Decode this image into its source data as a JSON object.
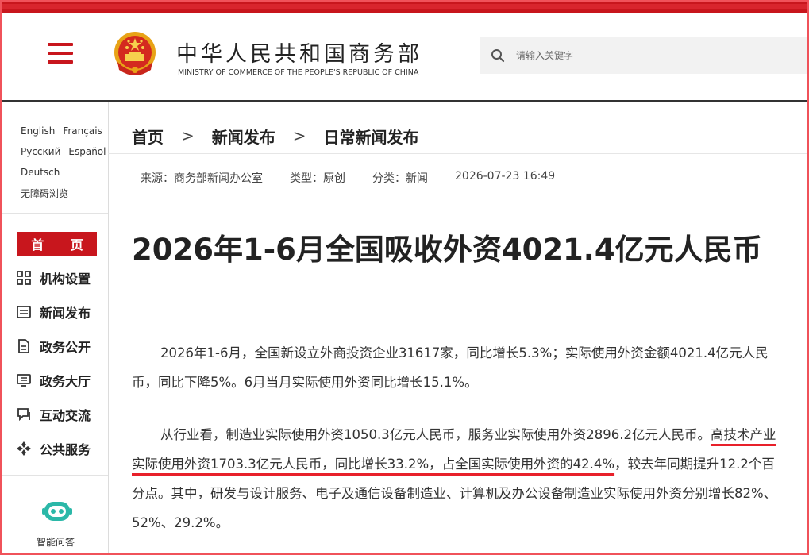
{
  "colors": {
    "brand_red": "#c8161d",
    "frame_red": "#f0525a",
    "highlight_red": "#e8202a"
  },
  "header": {
    "site_title_cn": "中华人民共和国商务部",
    "site_title_en": "MINISTRY OF COMMERCE OF THE PEOPLE'S REPUBLIC OF CHINA",
    "menu_icon": "hamburger-menu-icon",
    "emblem_icon": "national-emblem-icon",
    "search": {
      "placeholder": "请输入关键字",
      "icon": "search-icon"
    }
  },
  "sidebar": {
    "languages": [
      [
        "English",
        "Français"
      ],
      [
        "Русский",
        "Español"
      ],
      [
        "Deutsch"
      ],
      [
        "无障碍浏览"
      ]
    ],
    "home_label": "首 页",
    "nav_items": [
      {
        "label": "机构设置",
        "icon": "org-structure-icon"
      },
      {
        "label": "新闻发布",
        "icon": "news-icon"
      },
      {
        "label": "政务公开",
        "icon": "document-icon"
      },
      {
        "label": "政务大厅",
        "icon": "service-hall-icon"
      },
      {
        "label": "互动交流",
        "icon": "interaction-icon"
      },
      {
        "label": "公共服务",
        "icon": "public-service-icon"
      }
    ],
    "assistant": {
      "label": "智能问答",
      "icon": "robot-icon"
    }
  },
  "breadcrumb": [
    "首页",
    "新闻发布",
    "日常新闻发布"
  ],
  "breadcrumb_separator": ">",
  "meta": {
    "source": "来源：商务部新闻办公室",
    "type": "类型：原创",
    "category": "分类：新闻",
    "datetime": "2026-07-23 16:49"
  },
  "article": {
    "title": "2026年1-6月全国吸收外资4021.4亿元人民币",
    "p1": "2026年1-6月，全国新设立外商投资企业31617家，同比增长5.3%；实际使用外资金额4021.4亿元人民币，同比下降5%。6月当月实际使用外资同比增长15.1%。",
    "p2_before": "从行业看，制造业实际使用外资1050.3亿元人民币，服务业实际使用外资2896.2亿元人民币。",
    "p2_highlight": "高技术产业实际使用外资1703.3亿元人民币，同比增长33.2%，占全国实际使用外资的42.4%",
    "p2_after": "，较去年同期提升12.2个百分点。其中，研发与设计服务、电子及通信设备制造业、计算机及办公设备制造业实际使用外资分别增长82%、52%、29.2%。"
  }
}
